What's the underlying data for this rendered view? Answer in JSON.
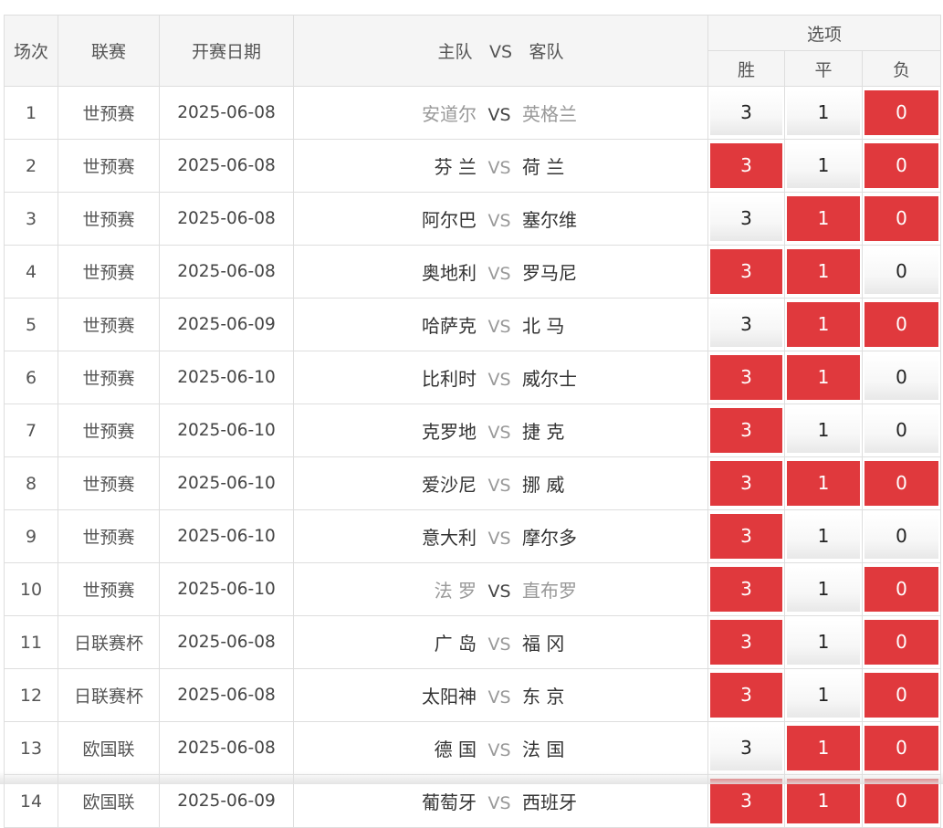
{
  "headers": {
    "index": "场次",
    "league": "联赛",
    "date": "开赛日期",
    "home": "主队",
    "vs": "VS",
    "away": "客队",
    "options": "选项",
    "win": "胜",
    "draw": "平",
    "loss": "负"
  },
  "colors": {
    "selected": "#e0393d",
    "border": "#dedede",
    "header_bg": "#f5f5f5"
  },
  "rows": [
    {
      "idx": "1",
      "league": "世预赛",
      "date": "2025-06-08",
      "home": "安道尔",
      "vs": "VS",
      "away": "英格兰",
      "win": "3",
      "draw": "1",
      "loss": "0",
      "win_on": false,
      "draw_on": false,
      "loss_on": true,
      "muted": true
    },
    {
      "idx": "2",
      "league": "世预赛",
      "date": "2025-06-08",
      "home": "芬 兰",
      "vs": "VS",
      "away": "荷 兰",
      "win": "3",
      "draw": "1",
      "loss": "0",
      "win_on": true,
      "draw_on": false,
      "loss_on": true,
      "muted": false
    },
    {
      "idx": "3",
      "league": "世预赛",
      "date": "2025-06-08",
      "home": "阿尔巴",
      "vs": "VS",
      "away": "塞尔维",
      "win": "3",
      "draw": "1",
      "loss": "0",
      "win_on": false,
      "draw_on": true,
      "loss_on": true,
      "muted": false
    },
    {
      "idx": "4",
      "league": "世预赛",
      "date": "2025-06-08",
      "home": "奥地利",
      "vs": "VS",
      "away": "罗马尼",
      "win": "3",
      "draw": "1",
      "loss": "0",
      "win_on": true,
      "draw_on": true,
      "loss_on": false,
      "muted": false
    },
    {
      "idx": "5",
      "league": "世预赛",
      "date": "2025-06-09",
      "home": "哈萨克",
      "vs": "VS",
      "away": "北 马",
      "win": "3",
      "draw": "1",
      "loss": "0",
      "win_on": false,
      "draw_on": true,
      "loss_on": true,
      "muted": false
    },
    {
      "idx": "6",
      "league": "世预赛",
      "date": "2025-06-10",
      "home": "比利时",
      "vs": "VS",
      "away": "威尔士",
      "win": "3",
      "draw": "1",
      "loss": "0",
      "win_on": true,
      "draw_on": true,
      "loss_on": false,
      "muted": false
    },
    {
      "idx": "7",
      "league": "世预赛",
      "date": "2025-06-10",
      "home": "克罗地",
      "vs": "VS",
      "away": "捷 克",
      "win": "3",
      "draw": "1",
      "loss": "0",
      "win_on": true,
      "draw_on": false,
      "loss_on": false,
      "muted": false
    },
    {
      "idx": "8",
      "league": "世预赛",
      "date": "2025-06-10",
      "home": "爱沙尼",
      "vs": "VS",
      "away": "挪 威",
      "win": "3",
      "draw": "1",
      "loss": "0",
      "win_on": true,
      "draw_on": true,
      "loss_on": true,
      "muted": false
    },
    {
      "idx": "9",
      "league": "世预赛",
      "date": "2025-06-10",
      "home": "意大利",
      "vs": "VS",
      "away": "摩尔多",
      "win": "3",
      "draw": "1",
      "loss": "0",
      "win_on": true,
      "draw_on": false,
      "loss_on": false,
      "muted": false
    },
    {
      "idx": "10",
      "league": "世预赛",
      "date": "2025-06-10",
      "home": "法 罗",
      "vs": "VS",
      "away": "直布罗",
      "win": "3",
      "draw": "1",
      "loss": "0",
      "win_on": true,
      "draw_on": false,
      "loss_on": true,
      "muted": true
    },
    {
      "idx": "11",
      "league": "日联赛杯",
      "date": "2025-06-08",
      "home": "广 岛",
      "vs": "VS",
      "away": "福 冈",
      "win": "3",
      "draw": "1",
      "loss": "0",
      "win_on": true,
      "draw_on": false,
      "loss_on": true,
      "muted": false
    },
    {
      "idx": "12",
      "league": "日联赛杯",
      "date": "2025-06-08",
      "home": "太阳神",
      "vs": "VS",
      "away": "东 京",
      "win": "3",
      "draw": "1",
      "loss": "0",
      "win_on": true,
      "draw_on": false,
      "loss_on": true,
      "muted": false
    },
    {
      "idx": "13",
      "league": "欧国联",
      "date": "2025-06-08",
      "home": "德 国",
      "vs": "VS",
      "away": "法 国",
      "win": "3",
      "draw": "1",
      "loss": "0",
      "win_on": false,
      "draw_on": true,
      "loss_on": true,
      "muted": false
    },
    {
      "idx": "14",
      "league": "欧国联",
      "date": "2025-06-09",
      "home": "葡萄牙",
      "vs": "VS",
      "away": "西班牙",
      "win": "3",
      "draw": "1",
      "loss": "0",
      "win_on": true,
      "draw_on": true,
      "loss_on": true,
      "muted": false
    }
  ]
}
